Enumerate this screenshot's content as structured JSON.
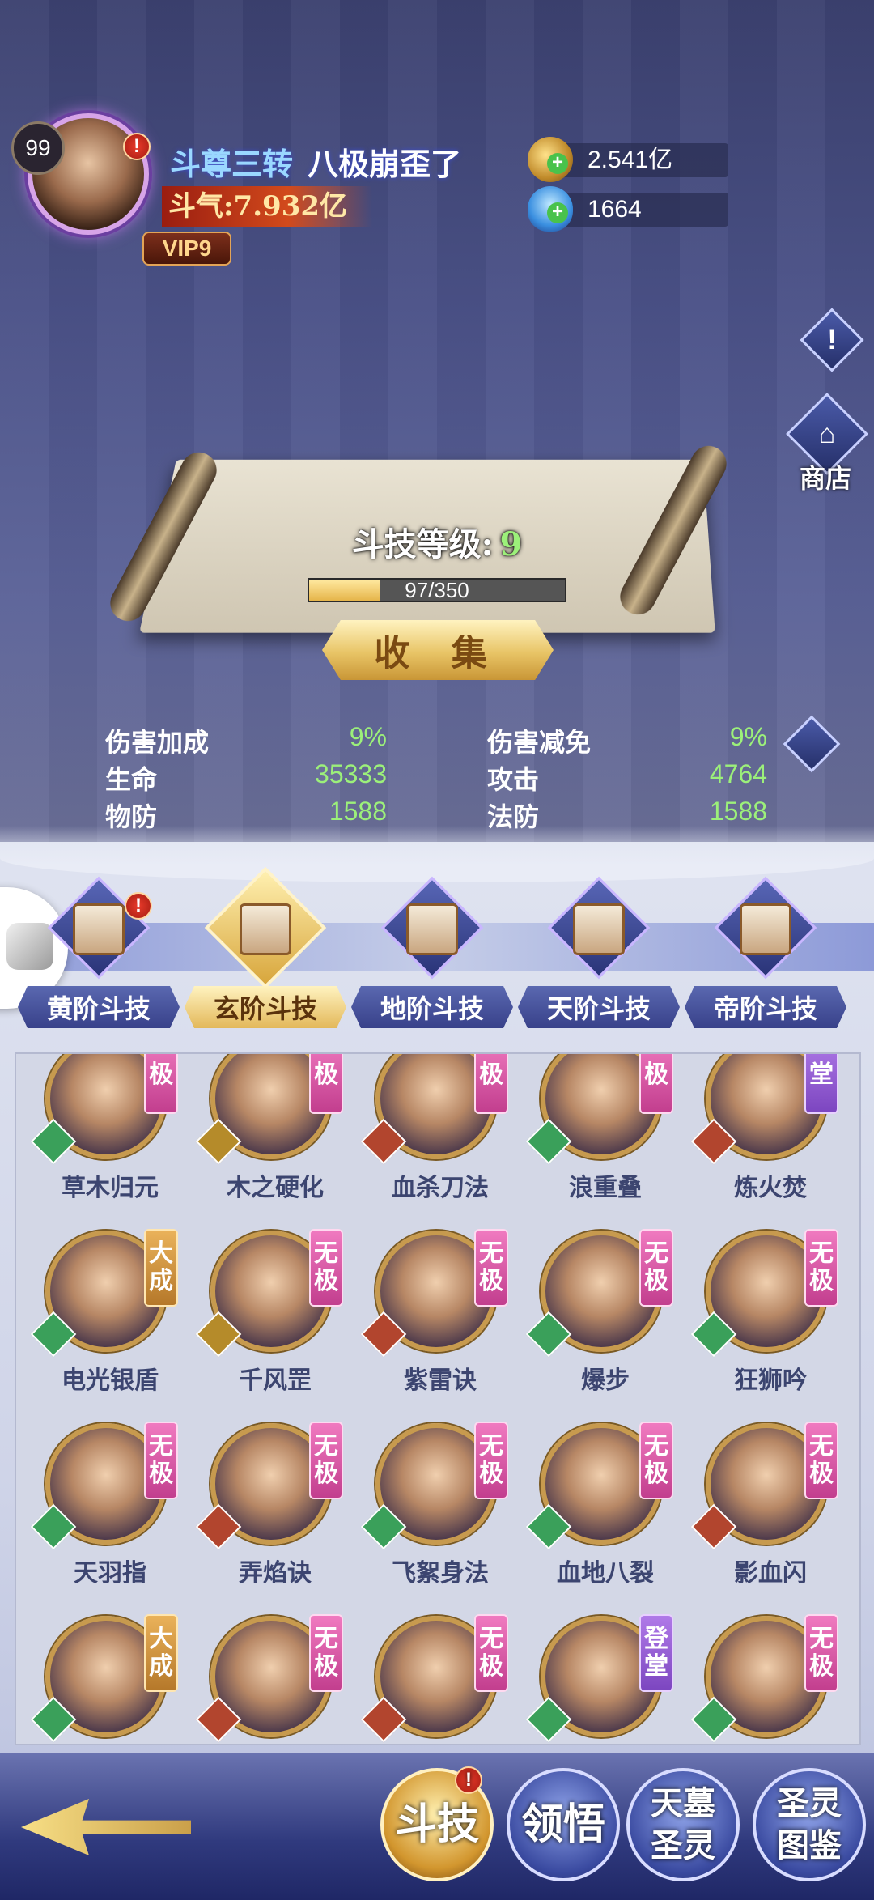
{
  "player": {
    "level": "99",
    "title": "斗尊三转",
    "name": "八极崩歪了",
    "combat_power": "斗气:7.932亿",
    "vip": "VIP9"
  },
  "resources": {
    "gold": "2.541亿",
    "diamond": "1664"
  },
  "side_buttons": {
    "info_icon": "!",
    "shop_label": "商店"
  },
  "skill_scroll": {
    "level_label": "斗技等级:",
    "level_value": "9",
    "exp_text": "97/350",
    "exp_fraction": 0.277,
    "collect_label": "收 集"
  },
  "stats": [
    {
      "label": "伤害加成",
      "value": "9%"
    },
    {
      "label": "伤害减免",
      "value": "9%"
    },
    {
      "label": "生命",
      "value": "35333"
    },
    {
      "label": "攻击",
      "value": "4764"
    },
    {
      "label": "物防",
      "value": "1588"
    },
    {
      "label": "法防",
      "value": "1588"
    }
  ],
  "tabs": [
    {
      "label": "黄阶斗技",
      "active": false,
      "alert": true
    },
    {
      "label": "玄阶斗技",
      "active": true,
      "alert": false
    },
    {
      "label": "地阶斗技",
      "active": false,
      "alert": false
    },
    {
      "label": "天阶斗技",
      "active": false,
      "alert": false
    },
    {
      "label": "帝阶斗技",
      "active": false,
      "alert": false
    }
  ],
  "skills": [
    {
      "name": "草木归元",
      "badge": "极",
      "badge_type": "wuji",
      "emblem": "green"
    },
    {
      "name": "木之硬化",
      "badge": "极",
      "badge_type": "wuji",
      "emblem": "gold"
    },
    {
      "name": "血杀刀法",
      "badge": "极",
      "badge_type": "wuji",
      "emblem": "red"
    },
    {
      "name": "浪重叠",
      "badge": "极",
      "badge_type": "wuji",
      "emblem": "green"
    },
    {
      "name": "炼火焚",
      "badge": "堂",
      "badge_type": "dengtang",
      "emblem": "red"
    },
    {
      "name": "电光银盾",
      "badge": "大成",
      "badge_type": "dacheng",
      "emblem": "green"
    },
    {
      "name": "千风罡",
      "badge": "无极",
      "badge_type": "wuji",
      "emblem": "gold"
    },
    {
      "name": "紫雷诀",
      "badge": "无极",
      "badge_type": "wuji",
      "emblem": "red"
    },
    {
      "name": "爆步",
      "badge": "无极",
      "badge_type": "wuji",
      "emblem": "green"
    },
    {
      "name": "狂狮吟",
      "badge": "无极",
      "badge_type": "wuji",
      "emblem": "green"
    },
    {
      "name": "天羽指",
      "badge": "无极",
      "badge_type": "wuji",
      "emblem": "green"
    },
    {
      "name": "弄焰诀",
      "badge": "无极",
      "badge_type": "wuji",
      "emblem": "red"
    },
    {
      "name": "飞絮身法",
      "badge": "无极",
      "badge_type": "wuji",
      "emblem": "green"
    },
    {
      "name": "血地八裂",
      "badge": "无极",
      "badge_type": "wuji",
      "emblem": "green"
    },
    {
      "name": "影血闪",
      "badge": "无极",
      "badge_type": "wuji",
      "emblem": "red"
    },
    {
      "name": "",
      "badge": "大成",
      "badge_type": "dacheng",
      "emblem": "green"
    },
    {
      "name": "",
      "badge": "无极",
      "badge_type": "wuji",
      "emblem": "red"
    },
    {
      "name": "",
      "badge": "无极",
      "badge_type": "wuji",
      "emblem": "red"
    },
    {
      "name": "",
      "badge": "登堂",
      "badge_type": "dengtang",
      "emblem": "green"
    },
    {
      "name": "",
      "badge": "无极",
      "badge_type": "wuji",
      "emblem": "green"
    }
  ],
  "bottom_nav": [
    {
      "label": "斗技",
      "active": true,
      "alert": true
    },
    {
      "label": "领悟",
      "active": false,
      "alert": false
    },
    {
      "label": "天墓圣灵",
      "active": false,
      "alert": false
    },
    {
      "label": "圣灵图鉴",
      "active": false,
      "alert": false
    }
  ],
  "alert_glyph": "!"
}
